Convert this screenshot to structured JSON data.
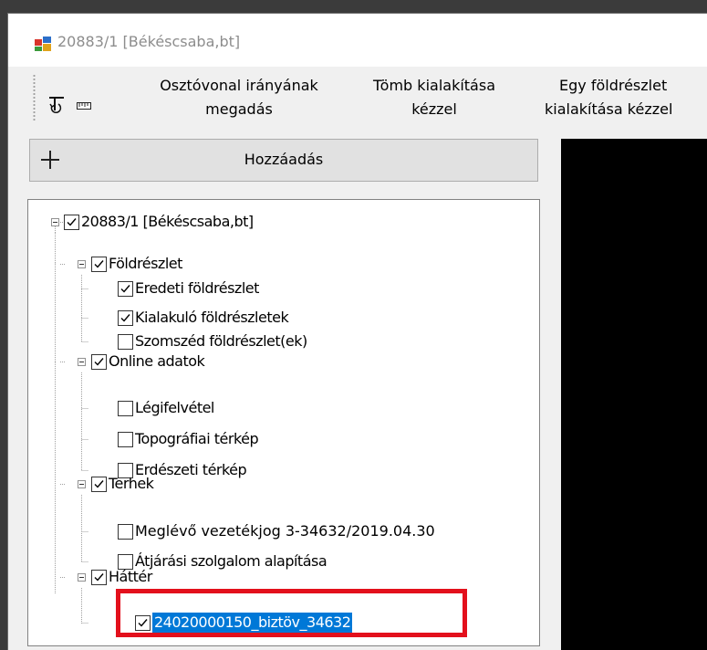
{
  "window": {
    "title": "20883/1 [Békéscsaba,bt]"
  },
  "toolbar": {
    "direction_label_line1": "Osztóvonal irányának",
    "direction_label_line2": "megadás",
    "block_label_line1": "Tömb kialakítása",
    "block_label_line2": "kézzel",
    "parcel_label_line1": "Egy földrészlet",
    "parcel_label_line2": "kialakítása kézzel"
  },
  "add_button": {
    "label": "Hozzáadás"
  },
  "tree": {
    "root": {
      "label": "20883/1 [Békéscsaba,bt]",
      "checked": true
    },
    "groups": [
      {
        "label": "Földrészlet",
        "checked": true,
        "items": [
          {
            "label": "Eredeti földrészlet",
            "checked": true
          },
          {
            "label": "Kialakuló földrészletek",
            "checked": true
          },
          {
            "label": "Szomszéd földrészlet(ek)",
            "checked": false
          }
        ]
      },
      {
        "label": "Online adatok",
        "checked": true,
        "items": [
          {
            "label": "Légifelvétel",
            "checked": false
          },
          {
            "label": "Topográfiai térkép",
            "checked": false
          },
          {
            "label": "Erdészeti térkép",
            "checked": false
          }
        ]
      },
      {
        "label": "Terhek",
        "checked": true,
        "items": [
          {
            "label": "Meglévő vezetékjog 3-34632/2019.04.30",
            "checked": false
          },
          {
            "label": "Átjárási szolgalom alapítása",
            "checked": false
          }
        ]
      },
      {
        "label": "Háttér",
        "checked": true,
        "items": [
          {
            "label": "24020000150_biztöv_34632",
            "checked": true,
            "selected": true
          }
        ]
      }
    ]
  },
  "colors": {
    "selection": "#0078d7",
    "highlight_box": "#e3101c",
    "canvas": "#000000"
  }
}
